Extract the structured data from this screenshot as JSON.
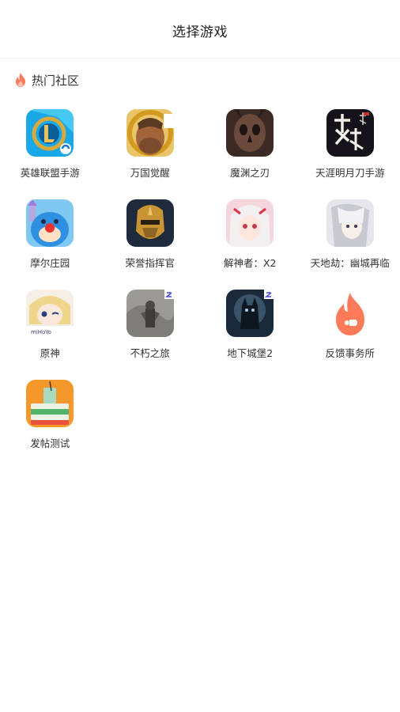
{
  "header": {
    "title": "选择游戏"
  },
  "section": {
    "label": "热门社区"
  },
  "games": [
    {
      "name": "英雄联盟手游",
      "icon": "league-of-legends-icon"
    },
    {
      "name": "万国觉醒",
      "icon": "rise-of-kingdoms-icon"
    },
    {
      "name": "魔渊之刃",
      "icon": "blade-of-abyss-icon"
    },
    {
      "name": "天涯明月刀手游",
      "icon": "moonlight-blade-icon"
    },
    {
      "name": "摩尔庄园",
      "icon": "mole-manor-icon"
    },
    {
      "name": "荣誉指挥官",
      "icon": "honor-commander-icon"
    },
    {
      "name": "解神者：X2",
      "icon": "x2-icon"
    },
    {
      "name": "天地劫：幽城再临",
      "icon": "tiandijie-icon"
    },
    {
      "name": "原神",
      "icon": "genshin-impact-icon"
    },
    {
      "name": "不朽之旅",
      "icon": "immortal-journey-icon"
    },
    {
      "name": "地下城堡2",
      "icon": "dungeon-castle-2-icon"
    },
    {
      "name": "反馈事务所",
      "icon": "feedback-office-icon"
    },
    {
      "name": "发帖测试",
      "icon": "post-test-icon"
    }
  ],
  "colors": {
    "accent": "#ff7a59",
    "text": "#333333",
    "title": "#222222"
  }
}
